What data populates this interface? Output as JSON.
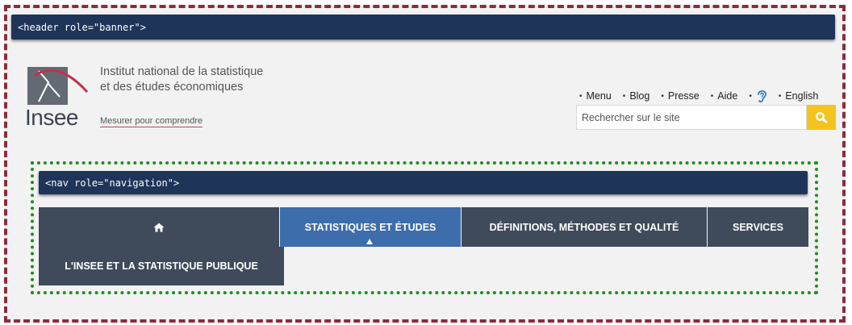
{
  "landmarks": {
    "header_label": "<header role=\"banner\">",
    "nav_label": "<nav role=\"navigation\">"
  },
  "brand": {
    "logo_word": "Insee",
    "institute_line1": "Institut national de la statistique",
    "institute_line2": "et des études économiques",
    "tagline": "Mesurer pour comprendre"
  },
  "top_links": [
    {
      "label": "Menu"
    },
    {
      "label": "Blog"
    },
    {
      "label": "Presse"
    },
    {
      "label": "Aide"
    },
    {
      "label": "",
      "icon": "ear-icon"
    },
    {
      "label": "English"
    }
  ],
  "search": {
    "placeholder": "Rechercher sur le site",
    "value": ""
  },
  "nav": {
    "home_icon": "home-icon",
    "stats": "STATISTIQUES ET ÉTUDES",
    "definitions": "DÉFINITIONS, MÉTHODES ET QUALITÉ",
    "services": "SERVICES",
    "insee": "L'INSEE ET LA STATISTIQUE PUBLIQUE"
  },
  "colors": {
    "banner_border": "#8e2a3c",
    "nav_border": "#1e8e1e",
    "landmark_label_bg": "#1e3458",
    "nav_item_bg": "#3f4b5b",
    "nav_active_bg": "#3d6dab",
    "search_button_bg": "#f5c31e"
  }
}
